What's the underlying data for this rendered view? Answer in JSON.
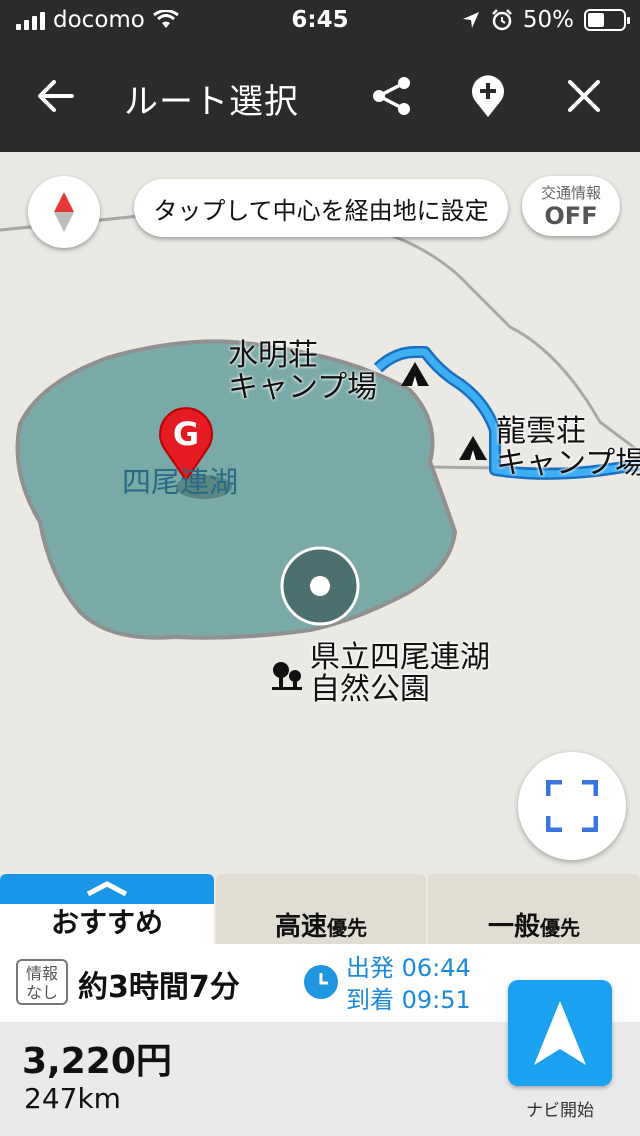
{
  "status": {
    "carrier": "docomo",
    "time": "6:45",
    "battery": "50%"
  },
  "header": {
    "title": "ルート選択",
    "back_icon": "arrow-left-icon",
    "share_icon": "share-icon",
    "add_waypoint_icon": "add-waypoint-icon",
    "close_icon": "close-icon"
  },
  "map": {
    "hint": "タップして中心を経由地に設定",
    "traffic": {
      "label": "交通情報",
      "value": "OFF"
    },
    "goal_marker": "G",
    "labels": {
      "lake": "四尾連湖",
      "camp1": "水明荘\nキャンプ場",
      "camp2": "龍雲荘\nキャンプ場",
      "park": "県立四尾連湖\n自然公園"
    },
    "colors": {
      "lake": "#79aaa8",
      "route": "#38a6f0",
      "goal": "#e41b23"
    }
  },
  "tabs": [
    {
      "label": "おすすめ",
      "sub": ""
    },
    {
      "label": "高速",
      "sub": "優先"
    },
    {
      "label": "一般",
      "sub": "優先"
    }
  ],
  "route": {
    "badge": "情報\nなし",
    "duration": "約3時間7分",
    "depart_label": "出発",
    "depart_time": "06:44",
    "arrive_label": "到着",
    "arrive_time": "09:51",
    "fare": "3,220円",
    "distance": "247km"
  },
  "nav": {
    "label": "ナビ開始"
  }
}
